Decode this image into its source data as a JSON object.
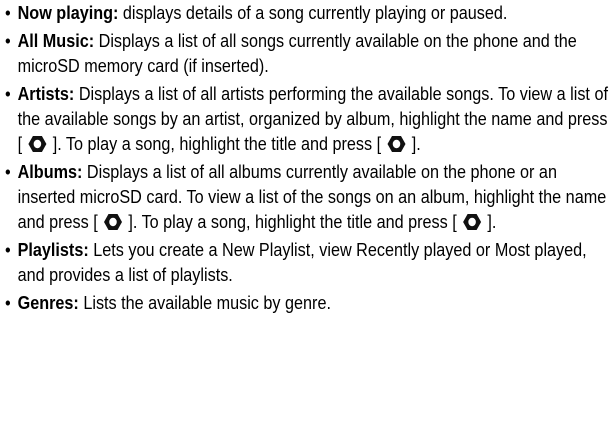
{
  "bullet_glyph": "•",
  "ok_key_icon": "ok-center-key-icon",
  "items": [
    {
      "term": "Now playing:",
      "text": " displays details of a song currently playing or paused."
    },
    {
      "term": "All Music:",
      "text": " Displays a list of all songs currently available on the phone and the microSD memory card (if inserted)."
    },
    {
      "term": "Artists:",
      "text_1": " Displays a list of all artists performing the available songs. To view a list of the available songs by an artist, organized by album, highlight the name and press [ ",
      "text_2": " ]. To play a song, highlight the title and press [ ",
      "text_3": " ]."
    },
    {
      "term": "Albums:",
      "text_1": " Displays a list of all albums currently available on the phone or an inserted microSD card. To view a list of the songs on an album, highlight the name and press [ ",
      "text_2": " ]. To play a song, highlight the title and press [ ",
      "text_3": " ]."
    },
    {
      "term": "Playlists:",
      "text": " Lets you create a New Playlist, view Recently played or Most played, and provides a list of playlists."
    },
    {
      "term": "Genres:",
      "text": " Lists the available music by genre."
    }
  ]
}
